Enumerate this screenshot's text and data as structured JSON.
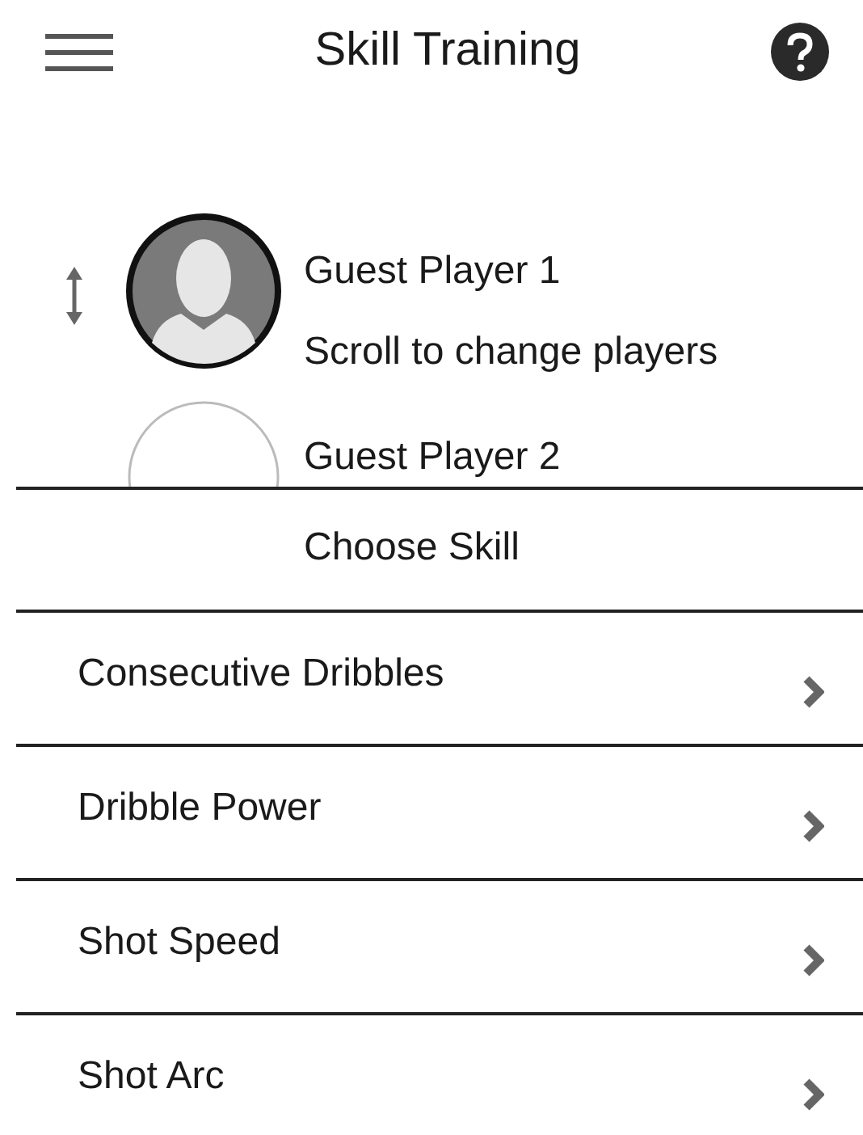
{
  "header": {
    "title": "Skill Training"
  },
  "player_picker": {
    "hint": "Scroll to change players",
    "players": [
      {
        "name": "Guest Player 1",
        "selected": true
      },
      {
        "name": "Guest Player 2",
        "selected": false
      }
    ]
  },
  "section_title": "Choose Skill",
  "skills": [
    {
      "label": "Consecutive Dribbles"
    },
    {
      "label": "Dribble Power"
    },
    {
      "label": "Shot Speed"
    },
    {
      "label": "Shot Arc"
    }
  ]
}
